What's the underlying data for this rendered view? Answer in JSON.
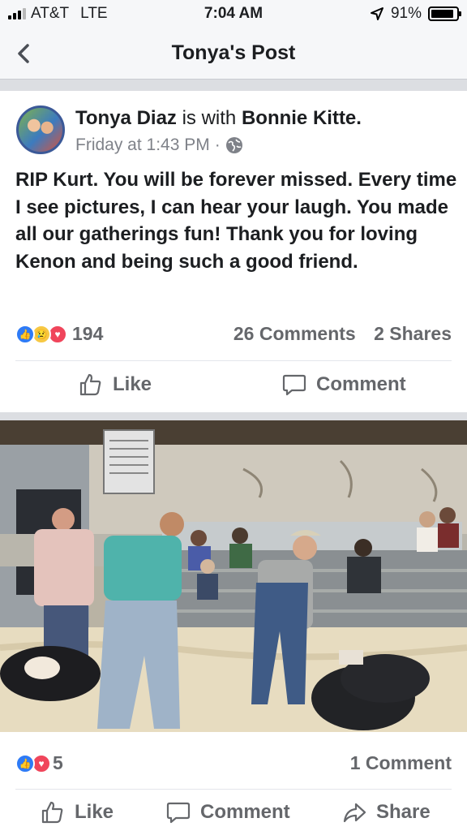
{
  "status_bar": {
    "carrier": "AT&T",
    "network": "LTE",
    "time": "7:04 AM",
    "battery": "91%",
    "battery_level": 0.91,
    "icons": [
      "signal-icon",
      "location-arrow-icon",
      "battery-icon"
    ]
  },
  "nav": {
    "title": "Tonya's Post",
    "back_icon": "chevron-left-icon"
  },
  "post": {
    "author": "Tonya Diaz",
    "with_text": "is with",
    "tagged": "Bonnie Kitte.",
    "timestamp": "Friday at 1:43 PM",
    "separator": "·",
    "privacy_icon": "globe-icon",
    "text": "RIP Kurt. You will be forever missed. Every time I see pictures, I can hear your laugh. You made all our gatherings fun! Thank you for loving Kenon and being such a good friend.",
    "reactions": [
      "like-reaction-icon",
      "sad-reaction-icon",
      "love-reaction-icon"
    ],
    "reaction_count": "194",
    "comments": "26 Comments",
    "shares": "2 Shares",
    "actions": {
      "like": "Like",
      "comment": "Comment"
    }
  },
  "photo_post": {
    "reactions": [
      "like-reaction-icon",
      "love-reaction-icon"
    ],
    "reaction_count": "5",
    "comments": "1 Comment",
    "actions": {
      "like": "Like",
      "comment": "Comment",
      "share": "Share"
    }
  },
  "colors": {
    "like_blue": "#2e7bf6",
    "love_red": "#f0455b",
    "sad_yellow": "#f7c843",
    "text_gray": "#65676b",
    "nav_bg": "#f6f7f9"
  }
}
